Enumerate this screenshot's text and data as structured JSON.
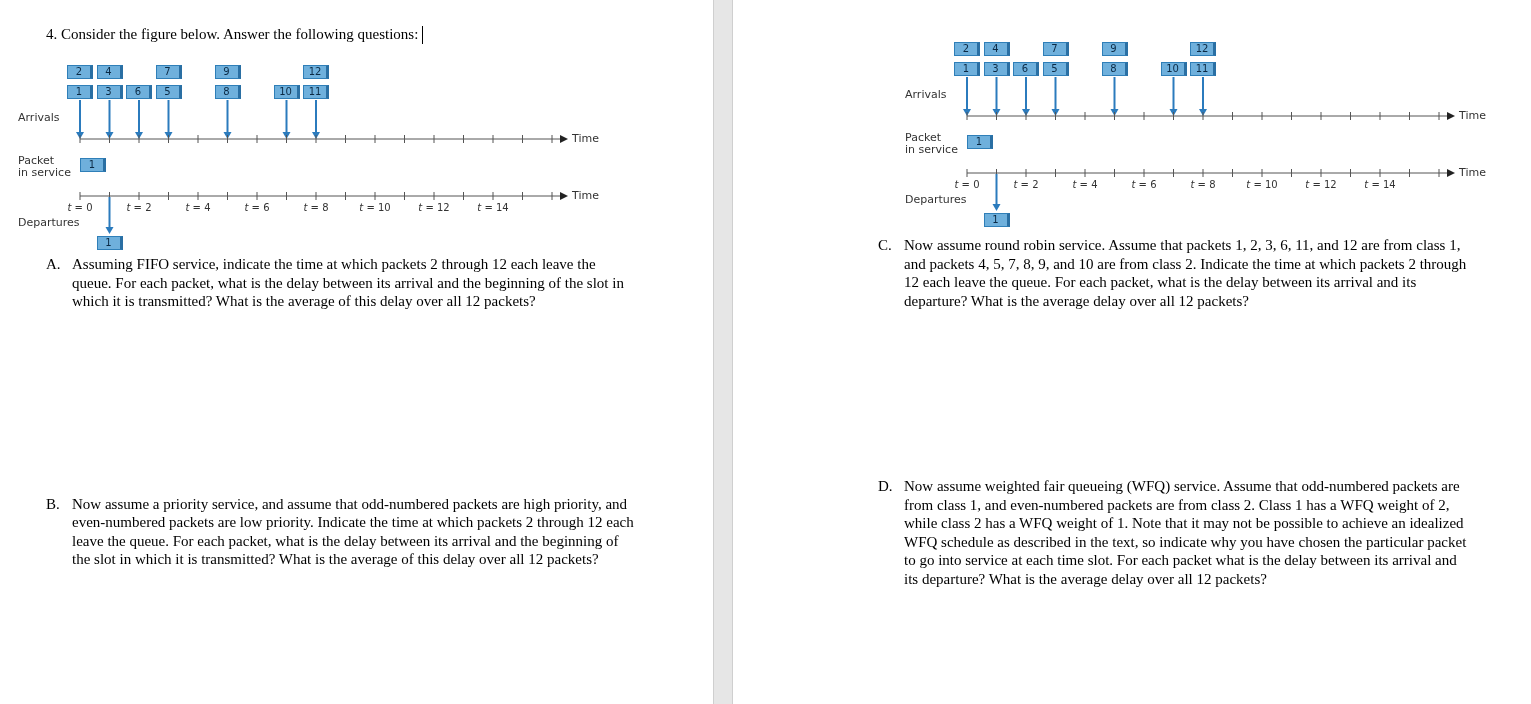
{
  "pages": [
    {
      "heading": {
        "number": "4.",
        "text": "Consider the figure below. Answer the following questions:"
      },
      "figure": {
        "labels": {
          "arrivals": "Arrivals",
          "service": [
            "Packet",
            "in service"
          ],
          "departures": "Departures",
          "time_arrivals": "Time",
          "time_departures": "Time"
        },
        "arrivals": [
          {
            "kind": "arrival",
            "packets": [
              "2",
              "1"
            ]
          },
          {
            "kind": "arrival",
            "packets": [
              "4",
              "3"
            ]
          },
          {
            "kind": "arrival",
            "packets": [
              "6"
            ]
          },
          {
            "kind": "arrival",
            "packets": [
              "7",
              "5"
            ]
          },
          {
            "kind": "empty"
          },
          {
            "kind": "arrival",
            "packets": [
              "9",
              "8"
            ]
          },
          {
            "kind": "empty"
          },
          {
            "kind": "arrival",
            "packets": [
              "10"
            ]
          },
          {
            "kind": "arrival",
            "packets": [
              "12",
              "11"
            ]
          }
        ],
        "in_service": [
          {
            "kind": "packet",
            "packet": "1"
          }
        ],
        "departures": [
          {
            "kind": "empty"
          },
          {
            "kind": "packet",
            "packet": "1"
          }
        ],
        "ticks": [
          "*t* = 0",
          "*t* = 2",
          "*t* = 4",
          "*t* = 6",
          "*t* = 8",
          "*t* = 10",
          "*t* = 12",
          "*t* = 14"
        ]
      },
      "questions": [
        {
          "label": "A.",
          "text": "Assuming FIFO service, indicate the time at which packets 2 through 12 each leave the queue. For each packet, what is the delay between its arrival and the beginning of the slot in which it is transmitted? What is the average of this delay over all 12 packets?"
        },
        {
          "label": "B.",
          "text": "Now assume a priority service, and assume that odd-numbered packets are high priority, and even-numbered packets are low priority. Indicate the time at which packets 2 through 12 each leave the queue. For each packet, what is the delay between its arrival and the beginning of the slot in which it is transmitted? What is the average of this delay over all 12 packets?"
        }
      ]
    },
    {
      "figure": {
        "labels": {
          "arrivals": "Arrivals",
          "service": [
            "Packet",
            "in service"
          ],
          "departures": "Departures",
          "time_arrivals": "Time",
          "time_departures": "Time"
        },
        "arrivals": [
          {
            "kind": "arrival",
            "packets": [
              "2",
              "1"
            ]
          },
          {
            "kind": "arrival",
            "packets": [
              "4",
              "3"
            ]
          },
          {
            "kind": "arrival",
            "packets": [
              "6"
            ]
          },
          {
            "kind": "arrival",
            "packets": [
              "7",
              "5"
            ]
          },
          {
            "kind": "empty"
          },
          {
            "kind": "arrival",
            "packets": [
              "9",
              "8"
            ]
          },
          {
            "kind": "empty"
          },
          {
            "kind": "arrival",
            "packets": [
              "10"
            ]
          },
          {
            "kind": "arrival",
            "packets": [
              "12",
              "11"
            ]
          }
        ],
        "in_service": [
          {
            "kind": "packet",
            "packet": "1"
          }
        ],
        "departures": [
          {
            "kind": "empty"
          },
          {
            "kind": "packet",
            "packet": "1"
          }
        ],
        "ticks": [
          "*t* = 0",
          "*t* = 2",
          "*t* = 4",
          "*t* = 6",
          "*t* = 8",
          "*t* = 10",
          "*t* = 12",
          "*t* = 14"
        ]
      },
      "questions": [
        {
          "label": "C.",
          "text": "Now assume round robin service. Assume that packets 1, 2, 3, 6, 11, and 12 are from class 1, and packets 4, 5, 7, 8, 9, and 10 are from class 2. Indicate the time at which packets 2 through 12 each leave the queue. For each packet, what is the delay between its arrival and its departure? What is the average delay over all 12 packets?"
        },
        {
          "label": "D.",
          "text": "Now assume weighted fair queueing (WFQ) service. Assume that odd-numbered packets are from class 1, and even-numbered packets are from class 2. Class 1 has a WFQ weight of 2, while class 2 has a WFQ weight of 1. Note that it may not be possible to achieve an idealized WFQ schedule as described in the text, so indicate why you have chosen the particular packet to go into service at each time slot. For each packet what is the delay between its arrival and its departure? What is the average delay over all 12 packets?"
        }
      ]
    }
  ]
}
